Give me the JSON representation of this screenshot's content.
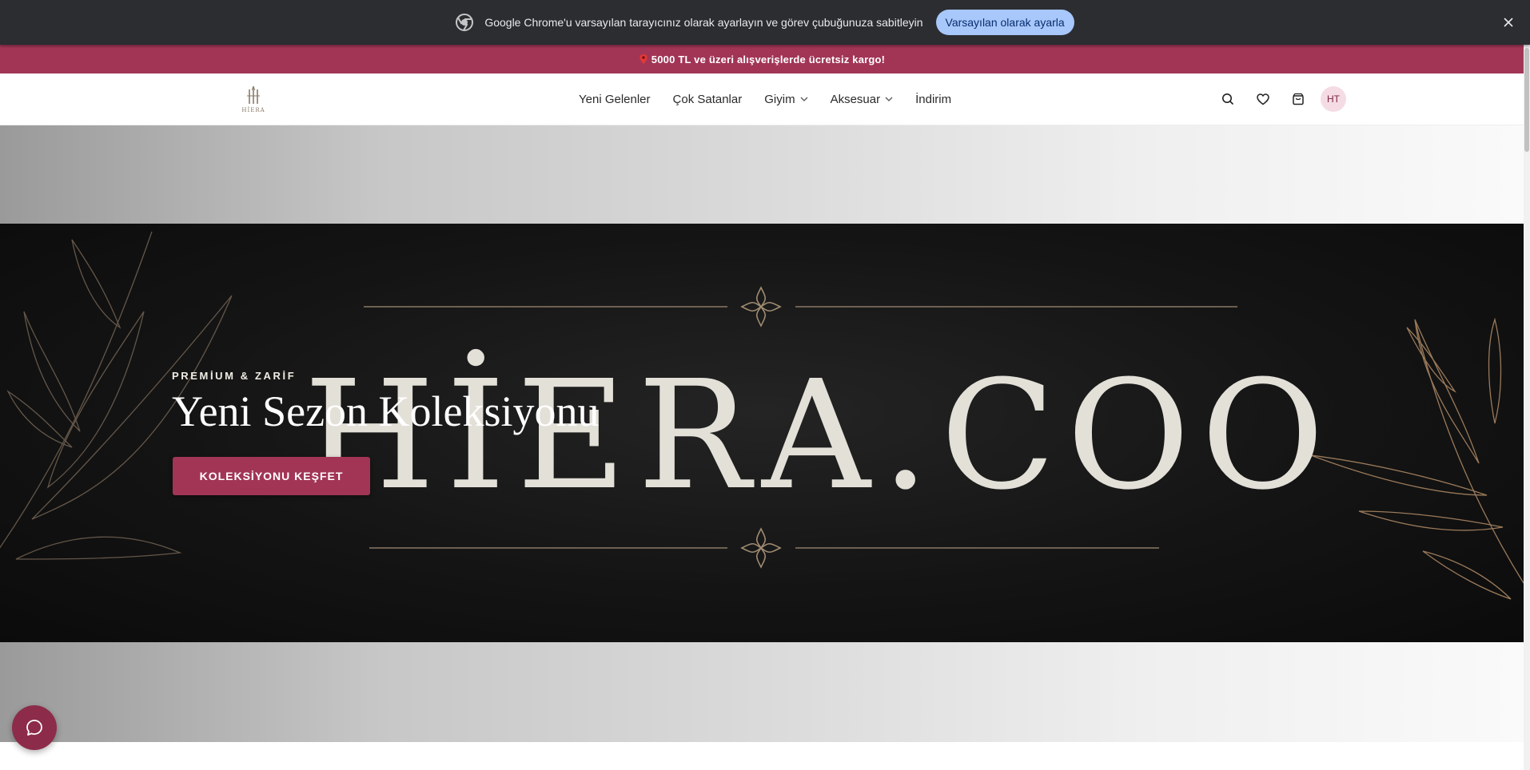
{
  "infobar": {
    "message": "Google Chrome'u varsayılan tarayıcınız olarak ayarlayın ve görev çubuğunuza sabitleyin",
    "button_label": "Varsayılan olarak ayarla",
    "icon": "chrome-icon",
    "close_icon": "close-icon"
  },
  "announcement": {
    "text": "5000 TL ve üzeri alışverişlerde ücretsiz kargo!",
    "icon": "pin-icon"
  },
  "header": {
    "logo_text": "HİERA",
    "nav": [
      {
        "label": "Yeni Gelenler"
      },
      {
        "label": "Çok Satanlar"
      },
      {
        "label": "Giyim"
      },
      {
        "label": "Aksesuar"
      },
      {
        "label": "İndirim"
      }
    ],
    "avatar_initials": "HT"
  },
  "hero": {
    "wordmark": "HİERA.COO",
    "kicker": "PREMİUM & ZARİF",
    "headline": "Yeni Sezon Koleksiyonu",
    "cta_label": "KOLEKSİYONU KEŞFET"
  },
  "colors": {
    "brand": "#a23556",
    "infobar_bg": "#2b2d31",
    "infobar_button": "#a8c7fa",
    "chat_button": "#8c2c4a"
  }
}
